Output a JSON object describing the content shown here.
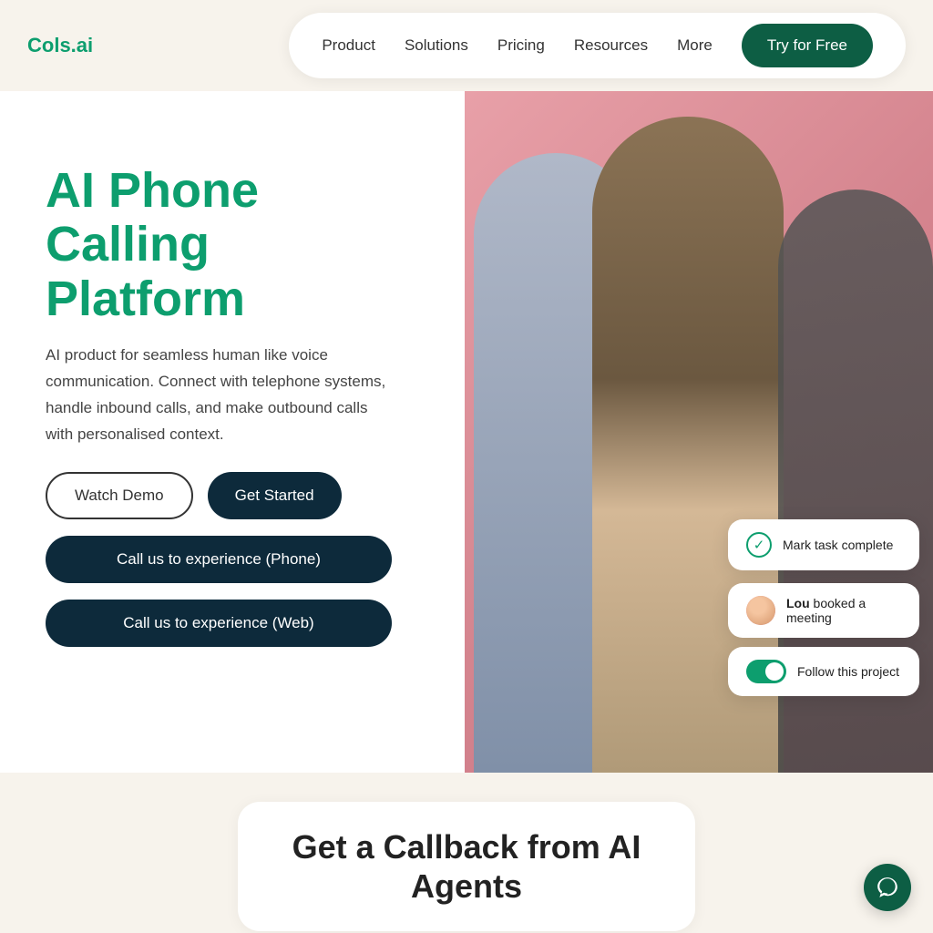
{
  "navbar": {
    "logo": "Cols.ai",
    "links": [
      {
        "label": "Product",
        "id": "product"
      },
      {
        "label": "Solutions",
        "id": "solutions"
      },
      {
        "label": "Pricing",
        "id": "pricing"
      },
      {
        "label": "Resources",
        "id": "resources"
      },
      {
        "label": "More",
        "id": "more"
      }
    ],
    "cta": "Try for Free"
  },
  "hero": {
    "title": "AI Phone Calling Platform",
    "subtitle": "AI product for seamless human like voice communication. Connect with telephone systems, handle inbound calls, and make outbound calls with personalised context.",
    "btn_watch": "Watch Demo",
    "btn_start": "Get Started",
    "btn_phone": "Call us to experience (Phone)",
    "btn_web": "Call us to experience (Web)"
  },
  "floating_cards": {
    "task": "Mark task complete",
    "meeting_name": "Lou",
    "meeting_action": " booked a meeting",
    "follow": "Follow this project"
  },
  "bottom": {
    "title": "Get a Callback from AI",
    "subtitle": "Agents"
  },
  "chat": {
    "icon": "chat-icon"
  }
}
